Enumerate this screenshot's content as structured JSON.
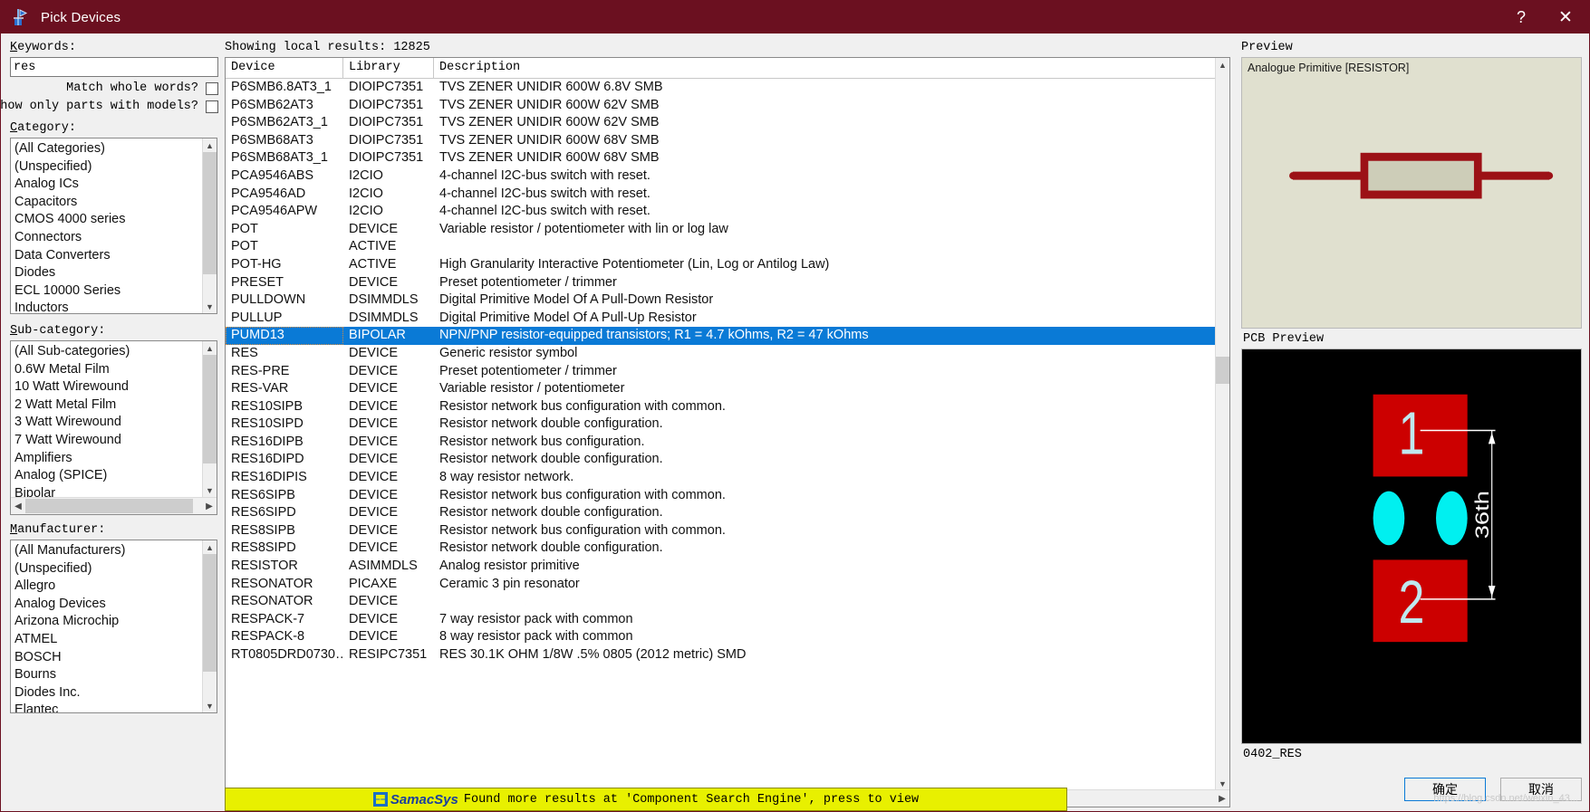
{
  "window": {
    "title": "Pick Devices",
    "app_icon": "proteus-pick-device-icon",
    "help_label": "?",
    "close_label": "✕",
    "titlebar_color": "#6b1020"
  },
  "search": {
    "keywords_label": "Keywords:",
    "keywords_value": "res",
    "keywords_placeholder": "",
    "match_whole_words_label": "Match whole words?",
    "match_whole_words_checked": false,
    "show_only_with_models_label": "Show only parts with models?",
    "show_only_with_models_checked": false
  },
  "category": {
    "label": "Category:",
    "items": [
      "(All Categories)",
      "(Unspecified)",
      "Analog ICs",
      "Capacitors",
      "CMOS 4000 series",
      "Connectors",
      "Data Converters",
      "Diodes",
      "ECL 10000 Series",
      "Inductors"
    ]
  },
  "subcategory": {
    "label": "Sub-category:",
    "items": [
      "(All Sub-categories)",
      "0.6W Metal Film",
      "10 Watt Wirewound",
      "2 Watt Metal Film",
      "3 Watt Wirewound",
      "7 Watt Wirewound",
      "Amplifiers",
      "Analog (SPICE)",
      "Bipolar"
    ]
  },
  "manufacturer": {
    "label": "Manufacturer:",
    "items": [
      "(All Manufacturers)",
      "(Unspecified)",
      "Allegro",
      "Analog Devices",
      "Arizona Microchip",
      "ATMEL",
      "BOSCH",
      "Bourns",
      "Diodes Inc.",
      "Elantec"
    ]
  },
  "results": {
    "showing_text": "Showing local results: 12825",
    "columns": [
      "Device",
      "Library",
      "Description"
    ],
    "selected_index": 14,
    "rows": [
      [
        "P6SMB6.8AT3_1",
        "DIOIPC7351",
        "TVS ZENER UNIDIR 600W 6.8V SMB"
      ],
      [
        "P6SMB62AT3",
        "DIOIPC7351",
        "TVS ZENER UNIDIR 600W 62V SMB"
      ],
      [
        "P6SMB62AT3_1",
        "DIOIPC7351",
        "TVS ZENER UNIDIR 600W 62V SMB"
      ],
      [
        "P6SMB68AT3",
        "DIOIPC7351",
        "TVS ZENER UNIDIR 600W 68V SMB"
      ],
      [
        "P6SMB68AT3_1",
        "DIOIPC7351",
        "TVS ZENER UNIDIR 600W 68V SMB"
      ],
      [
        "PCA9546ABS",
        "I2CIO",
        "4-channel I2C-bus switch with reset."
      ],
      [
        "PCA9546AD",
        "I2CIO",
        "4-channel I2C-bus switch with reset."
      ],
      [
        "PCA9546APW",
        "I2CIO",
        "4-channel I2C-bus switch with reset."
      ],
      [
        "POT",
        "DEVICE",
        "Variable resistor / potentiometer with lin or log law"
      ],
      [
        "POT",
        "ACTIVE",
        ""
      ],
      [
        "POT-HG",
        "ACTIVE",
        "High Granularity Interactive Potentiometer (Lin, Log or Antilog Law)"
      ],
      [
        "PRESET",
        "DEVICE",
        "Preset potentiometer / trimmer"
      ],
      [
        "PULLDOWN",
        "DSIMMDLS",
        "Digital Primitive Model Of A Pull-Down Resistor"
      ],
      [
        "PULLUP",
        "DSIMMDLS",
        "Digital Primitive Model Of A Pull-Up Resistor"
      ],
      [
        "PUMD13",
        "BIPOLAR",
        "NPN/PNP resistor-equipped transistors; R1 = 4.7 kOhms, R2 = 47 kOhms"
      ],
      [
        "RES",
        "DEVICE",
        "Generic resistor symbol"
      ],
      [
        "RES-PRE",
        "DEVICE",
        "Preset potentiometer / trimmer"
      ],
      [
        "RES-VAR",
        "DEVICE",
        "Variable resistor / potentiometer"
      ],
      [
        "RES10SIPB",
        "DEVICE",
        "Resistor network bus configuration with common."
      ],
      [
        "RES10SIPD",
        "DEVICE",
        "Resistor network double configuration."
      ],
      [
        "RES16DIPB",
        "DEVICE",
        "Resistor network bus configuration."
      ],
      [
        "RES16DIPD",
        "DEVICE",
        "Resistor network double configuration."
      ],
      [
        "RES16DIPIS",
        "DEVICE",
        "8 way resistor network."
      ],
      [
        "RES6SIPB",
        "DEVICE",
        "Resistor network bus configuration with common."
      ],
      [
        "RES6SIPD",
        "DEVICE",
        "Resistor network double configuration."
      ],
      [
        "RES8SIPB",
        "DEVICE",
        "Resistor network bus configuration with common."
      ],
      [
        "RES8SIPD",
        "DEVICE",
        "Resistor network double configuration."
      ],
      [
        "RESISTOR",
        "ASIMMDLS",
        "Analog resistor primitive"
      ],
      [
        "RESONATOR",
        "PICAXE",
        "Ceramic 3 pin resonator"
      ],
      [
        "RESONATOR",
        "DEVICE",
        ""
      ],
      [
        "RESPACK-7",
        "DEVICE",
        "7 way resistor pack with common"
      ],
      [
        "RESPACK-8",
        "DEVICE",
        "8 way resistor pack with common"
      ],
      [
        "RT0805DRD0730…",
        "RESIPC7351",
        "RES 30.1K OHM 1/8W .5% 0805 (2012 metric) SMD"
      ]
    ]
  },
  "preview": {
    "label": "Preview",
    "caption": "Analogue Primitive [RESISTOR]",
    "background_color": "#e0e0cf",
    "symbol_color": "#9c1116"
  },
  "pcb_preview": {
    "label": "PCB Preview",
    "footprint_name": "0402_RES",
    "pad_labels": [
      "1",
      "2"
    ],
    "dimension_label": "36th",
    "pad_color": "#cc0000",
    "hole_color": "#00f0f0",
    "background_color": "#000000"
  },
  "banner": {
    "logo_text": "SamacSys",
    "message": "Found more results at 'Component Search Engine', press to view",
    "background_color": "#e8f000"
  },
  "buttons": {
    "ok": "确定",
    "cancel": "取消"
  },
  "watermark": "https://blog.csdn.net/weixin_43..."
}
